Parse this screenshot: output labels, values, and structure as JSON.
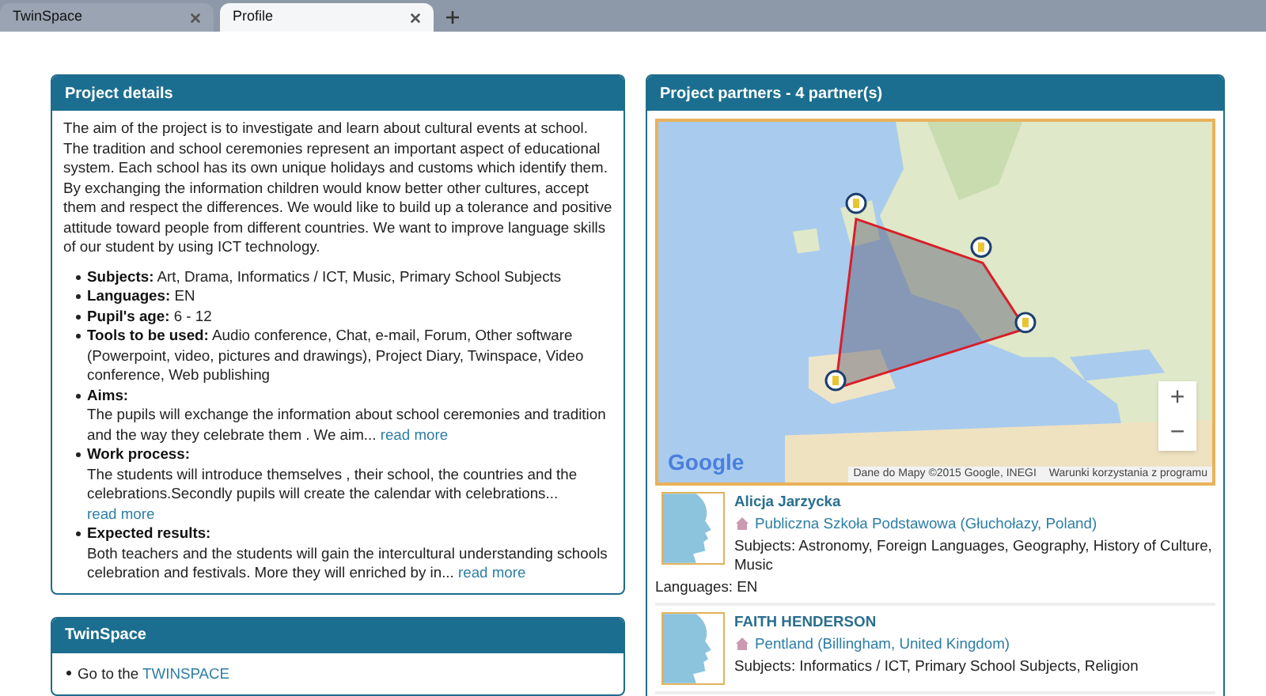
{
  "browser_tabs": [
    {
      "label": "TwinSpace",
      "selected": false
    },
    {
      "label": "Profile",
      "selected": true
    }
  ],
  "project_details": {
    "title": "Project details",
    "description": "The aim of the project is to investigate and learn about cultural events at school. The tradition and school ceremonies represent an important aspect of educational system. Each school has its own unique holidays and customs which identify them. By exchanging the information children would know better other cultures, accept them and respect the differences. We would like to build up a tolerance and positive attitude toward people from different countries. We want to improve language skills of our student by using ICT technology.",
    "items": [
      {
        "label": "Subjects:",
        "value": "Art, Drama, Informatics / ICT, Music, Primary School Subjects",
        "kind": "inline"
      },
      {
        "label": "Languages:",
        "value": "EN",
        "kind": "inline"
      },
      {
        "label": "Pupil's age:",
        "value": "6 - 12",
        "kind": "inline"
      },
      {
        "label": "Tools to be used:",
        "value": "Audio conference, Chat, e-mail, Forum, Other software (Powerpoint, video, pictures and drawings), Project Diary, Twinspace, Video conference, Web publishing",
        "kind": "inline"
      },
      {
        "label": "Aims:",
        "value": "The pupils will exchange the information about school ceremonies and tradition and the way they celebrate them . We aim...",
        "link": "read more",
        "kind": "block"
      },
      {
        "label": "Work process:",
        "value": "The students will introduce themselves , their school, the countries and the celebrations.Secondly pupils will create the calendar with celebrations...",
        "link": "read more",
        "kind": "block"
      },
      {
        "label": "Expected results:",
        "value": "Both teachers and the students will gain the intercultural understanding schools celebration and festivals. More they will enriched by in...",
        "link": "read more",
        "kind": "block"
      }
    ]
  },
  "twinspace": {
    "title": "TwinSpace",
    "text": "Go to the",
    "link": "TWINSPACE"
  },
  "project_partners": {
    "title": "Project partners - 4 partner(s)",
    "map": {
      "kind": "picture",
      "zoom_in": "+",
      "zoom_out": "−",
      "logo": "Google",
      "attribution": "Dane do Mapy ©2015 Google, INEGI",
      "terms": "Warunki korzystania z programu"
    },
    "partners": [
      {
        "name": "Alicja Jarzycka",
        "school": "Publiczna Szkoła Podstawowa (Głuchołazy, Poland)",
        "subjects": "Subjects: Astronomy, Foreign Languages, Geography, History of Culture, Music",
        "languages": "Languages: EN"
      },
      {
        "name": "FAITH HENDERSON",
        "school": "Pentland (Billingham, United Kingdom)",
        "subjects": "Subjects: Informatics / ICT, Primary School Subjects, Religion"
      }
    ]
  }
}
